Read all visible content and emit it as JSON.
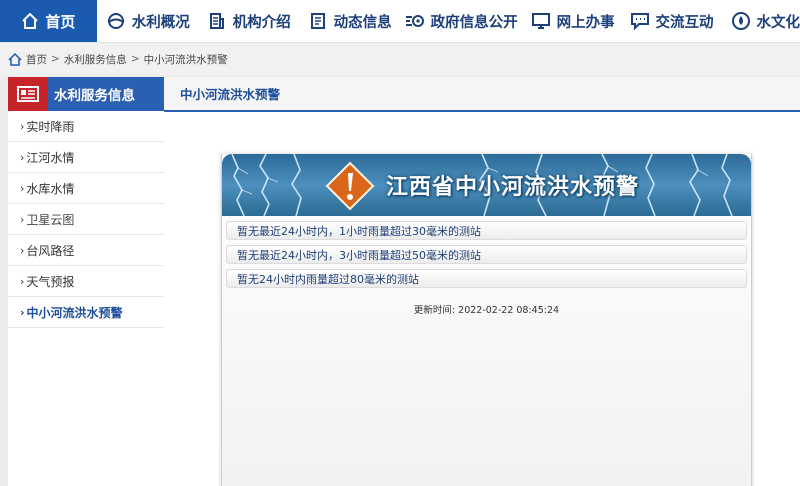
{
  "nav": {
    "home": "首页",
    "items": [
      {
        "label": "水利概况",
        "icon": "water-globe-icon"
      },
      {
        "label": "机构介绍",
        "icon": "building-icon"
      },
      {
        "label": "动态信息",
        "icon": "document-icon"
      },
      {
        "label": "政府信息公开",
        "icon": "eye-list-icon"
      },
      {
        "label": "网上办事",
        "icon": "monitor-icon"
      },
      {
        "label": "交流互动",
        "icon": "chat-icon"
      },
      {
        "label": "水文化",
        "icon": "water-drop-icon"
      }
    ]
  },
  "breadcrumb": {
    "home": "首页",
    "level1": "水利服务信息",
    "level2": "中小河流洪水预警",
    "sep": ">"
  },
  "sidebar": {
    "title": "水利服务信息",
    "items": [
      {
        "label": "实时降雨"
      },
      {
        "label": "江河水情"
      },
      {
        "label": "水库水情"
      },
      {
        "label": "卫星云图"
      },
      {
        "label": "台风路径"
      },
      {
        "label": "天气预报"
      },
      {
        "label": "中小河流洪水预警"
      }
    ]
  },
  "main": {
    "tab": "中小河流洪水预警",
    "banner_title": "江西省中小河流洪水预警",
    "rows": [
      "暂无最近24小时内，1小时雨量超过30毫米的测站",
      "暂无最近24小时内，3小时雨量超过50毫米的测站",
      "暂无24小时内雨量超过80毫米的测站"
    ],
    "update_label": "更新时间:",
    "update_time": "2022-02-22 08:45:24"
  },
  "colors": {
    "nav_blue": "#1a5bb0",
    "nav_text": "#1d3f7a",
    "sidebar_red": "#c7242a",
    "accent_blue": "#2a5fb2",
    "warning_orange": "#d9661a"
  }
}
